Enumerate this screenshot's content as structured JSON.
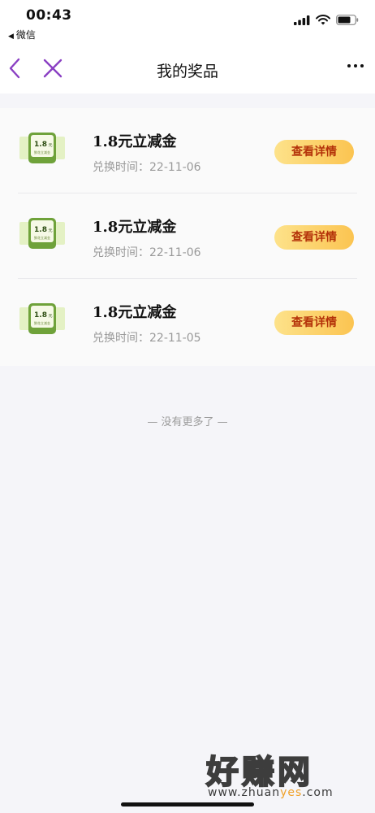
{
  "status": {
    "time": "00:43",
    "back_app": "微信"
  },
  "nav": {
    "title": "我的奖品"
  },
  "thumb_text": {
    "amount": "1.8",
    "unit": "元",
    "caption": "鲜花立减金"
  },
  "items": [
    {
      "name": "1.8元立减金",
      "date_label": "兑换时间：",
      "date": "22-11-06",
      "button": "查看详情"
    },
    {
      "name": "1.8元立减金",
      "date_label": "兑换时间：",
      "date": "22-11-06",
      "button": "查看详情"
    },
    {
      "name": "1.8元立减金",
      "date_label": "兑换时间：",
      "date": "22-11-05",
      "button": "查看详情"
    }
  ],
  "footer": {
    "no_more": "— 没有更多了 —"
  },
  "watermark": {
    "big": "好赚网",
    "small_pre": "www.zhuan",
    "small_hl": "yes",
    "small_post": ".com"
  },
  "colors": {
    "accent": "#8a3fc3",
    "button_text": "#b4330a",
    "button_start": "#fde28a",
    "button_end": "#fbc451"
  }
}
